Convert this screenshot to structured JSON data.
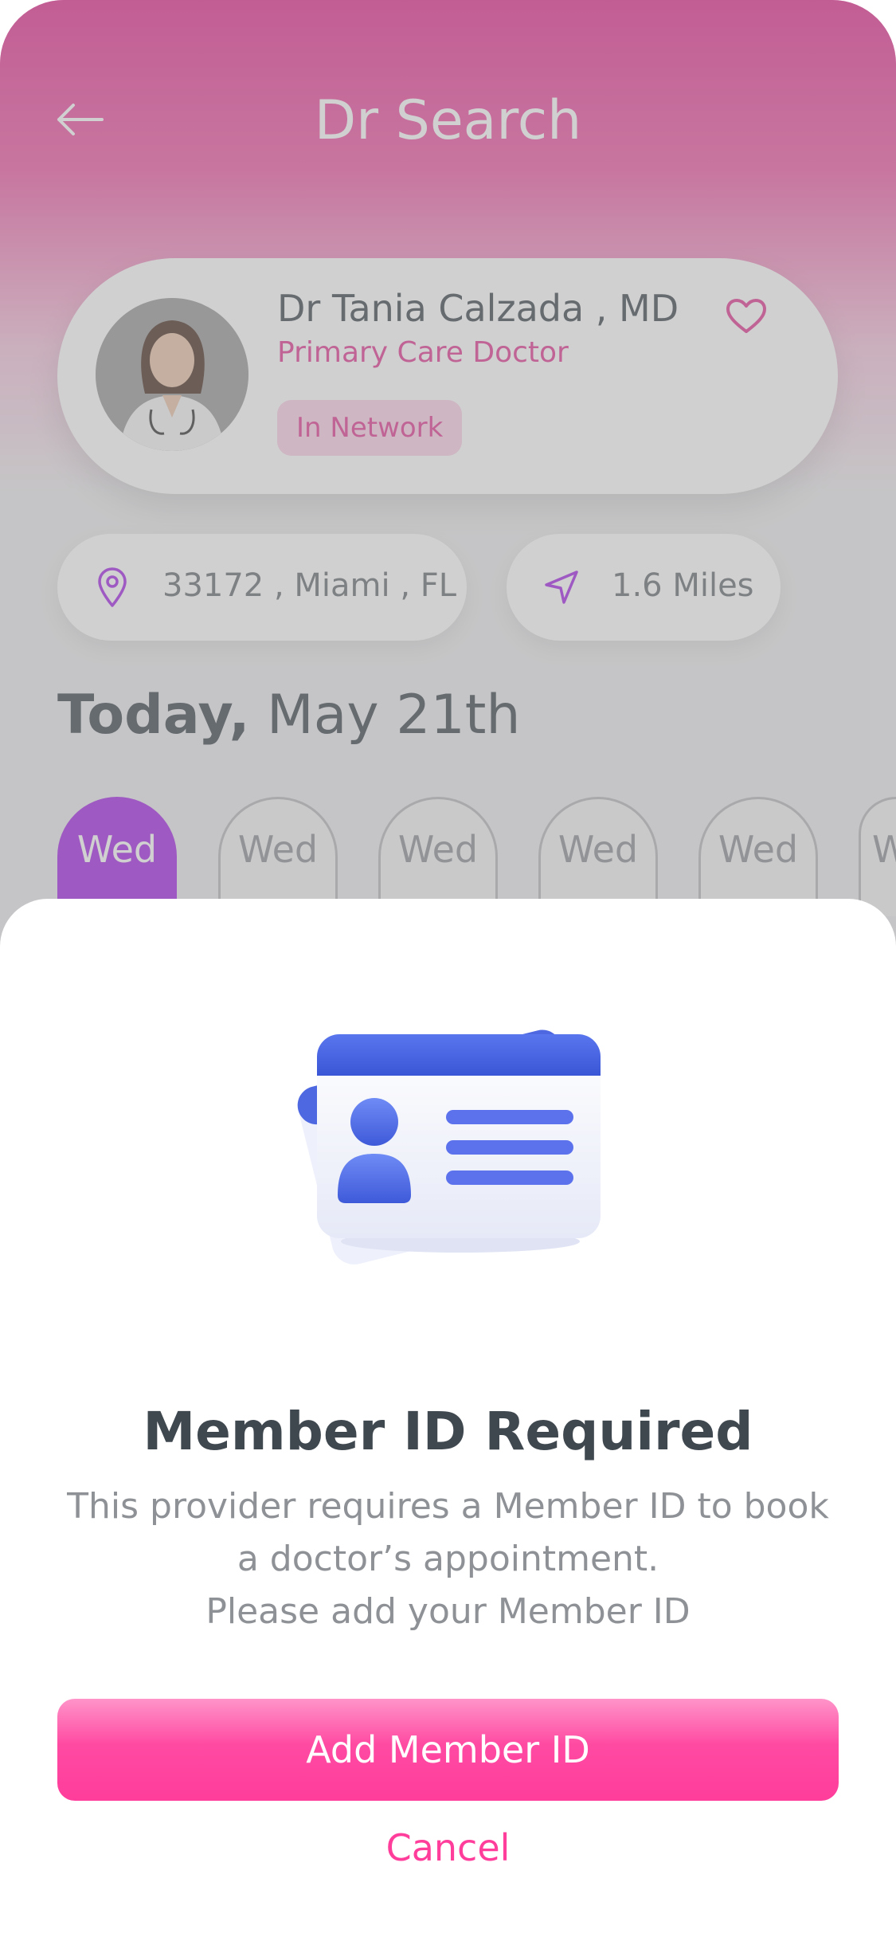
{
  "header": {
    "title": "Dr Search",
    "back_icon": "arrow-left-icon"
  },
  "doctor": {
    "name": "Dr Tania Calzada , MD",
    "specialty": "Primary Care Doctor",
    "network_status": "In Network",
    "favorite_icon": "heart-icon"
  },
  "location": {
    "address": "33172 , Miami , FL",
    "address_icon": "map-pin-icon",
    "distance": "1.6 Miles",
    "distance_icon": "navigation-arrow-icon"
  },
  "schedule": {
    "date_bold": "Today,",
    "date_rest": " May 21th",
    "days": [
      {
        "label": "Wed",
        "active": true
      },
      {
        "label": "Wed",
        "active": false
      },
      {
        "label": "Wed",
        "active": false
      },
      {
        "label": "Wed",
        "active": false
      },
      {
        "label": "Wed",
        "active": false
      },
      {
        "label": "W",
        "active": false
      }
    ]
  },
  "modal": {
    "illustration_icon": "id-card-icon",
    "title": "Member ID Required",
    "message_line1": "This provider requires a Member ID to book",
    "message_line2": "a doctor’s appointment.",
    "message_line3": "Please add your Member ID",
    "primary_button": "Add Member ID",
    "cancel_button": "Cancel"
  },
  "colors": {
    "brand_pink": "#ff3d9b",
    "accent_purple": "#a429e5",
    "text_dark": "#3f474f",
    "text_muted": "#8e9196",
    "id_card_blue": "#4a63e0"
  }
}
